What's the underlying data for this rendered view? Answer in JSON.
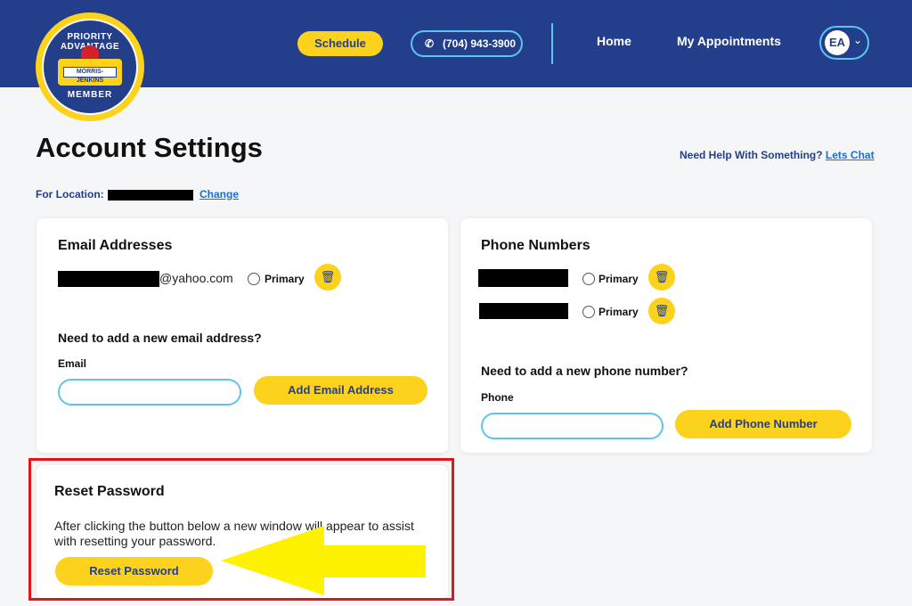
{
  "header": {
    "logo": {
      "top_text": "PRIORITY ADVANTAGE",
      "badge_text": "MORRIS-JENKINS",
      "bottom_text": "MEMBER"
    },
    "schedule_label": "Schedule",
    "phone_label": "(704) 943-3900",
    "nav": {
      "home": "Home",
      "appointments": "My Appointments"
    },
    "avatar_initials": "EA"
  },
  "page": {
    "title": "Account Settings",
    "help_text": "Need Help With Something?",
    "help_link": "Lets Chat",
    "location_label": "For Location:",
    "location_change": "Change"
  },
  "email_card": {
    "title": "Email Addresses",
    "email_domain": "@yahoo.com",
    "primary_label": "Primary",
    "add_question": "Need to add a new email address?",
    "field_label": "Email",
    "input_value": "",
    "add_button": "Add Email Address"
  },
  "phone_card": {
    "title": "Phone Numbers",
    "primary_label": "Primary",
    "add_question": "Need to add a new phone number?",
    "field_label": "Phone",
    "input_value": "",
    "add_button": "Add Phone Number"
  },
  "reset_card": {
    "title": "Reset Password",
    "description": "After clicking the button below a new window will appear to assist with resetting your password.",
    "button": "Reset Password"
  },
  "icons": {
    "phone": "phone-icon",
    "trash": "trash-icon",
    "chevron": "chevron-down-icon",
    "arrow": "arrow-left-icon"
  },
  "colors": {
    "header_bg": "#233f8c",
    "accent_yellow": "#fcd21c",
    "accent_cyan": "#5cc4ee",
    "link": "#1a6fd1",
    "highlight_red": "#e3141b",
    "arrow_yellow": "#fff200"
  }
}
